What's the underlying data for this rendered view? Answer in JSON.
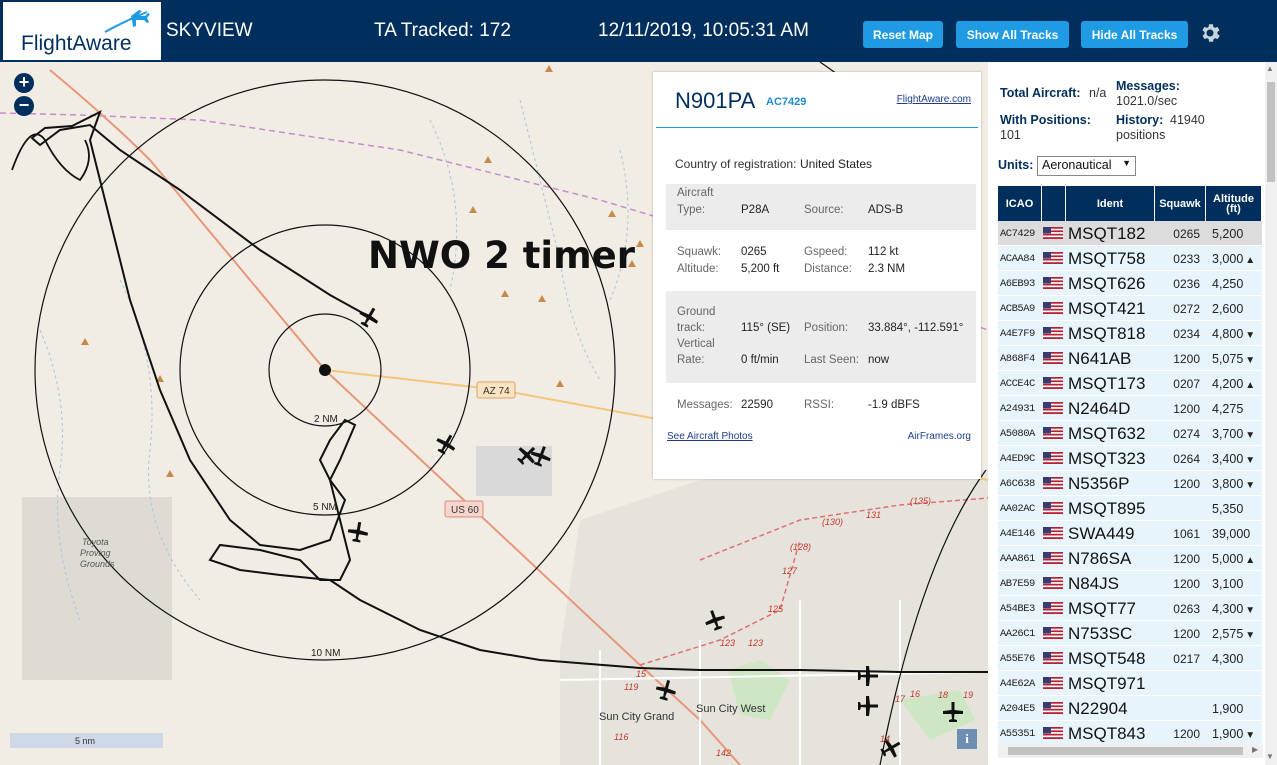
{
  "header": {
    "logo_text": "FlightAware",
    "app_title": "SKYVIEW",
    "ta_tracked": "TA Tracked: 172",
    "datetime": "12/11/2019, 10:05:31 AM",
    "reset_map": "Reset Map",
    "show_all_tracks": "Show All Tracks",
    "hide_all_tracks": "Hide All Tracks",
    "settings_icon": "gear-icon",
    "bg_color": "#002f5d",
    "button_color": "#1e9be3"
  },
  "map": {
    "zoom_in": "+",
    "zoom_out": "−",
    "annotation": "NWO 2 timer",
    "ring_labels": [
      "2 NM",
      "5 NM",
      "10 NM"
    ],
    "road_labels": [
      "AZ 74",
      "US 60"
    ],
    "place_labels": [
      "Toyota",
      "Proving",
      "Grounds",
      "Sun City Grand",
      "Sun City West"
    ],
    "route_numbers": [
      "(135)",
      "(130)",
      "131",
      "(128)",
      "127",
      "125",
      "123",
      "123",
      "17",
      "16",
      "18",
      "19",
      "15",
      "119",
      "116",
      "142",
      "14"
    ],
    "scale_label": "5 nm",
    "info_icon": "i"
  },
  "popup": {
    "registration": "N901PA",
    "icao": "AC7429",
    "link_flightaware": "FlightAware.com",
    "country_label": "Country of registration:",
    "country_value": "United States",
    "aircraft_type_label_1": "Aircraft",
    "aircraft_type_label_2": "Type:",
    "aircraft_type_value": "P28A",
    "source_label": "Source:",
    "source_value": "ADS-B",
    "squawk_label": "Squawk:",
    "squawk_value": "0265",
    "gspeed_label": "Gspeed:",
    "gspeed_value": "112 kt",
    "altitude_label": "Altitude:",
    "altitude_value": "5,200 ft",
    "distance_label": "Distance:",
    "distance_value": "2.3 NM",
    "track_label_1": "Ground",
    "track_label_2": "track:",
    "track_value": "115° (SE)",
    "position_label": "Position:",
    "position_value": "33.884°, -112.591°",
    "vrate_label_1": "Vertical",
    "vrate_label_2": "Rate:",
    "vrate_value": "0 ft/min",
    "last_seen_label": "Last Seen:",
    "last_seen_value": "now",
    "messages_label": "Messages:",
    "messages_value": "22590",
    "rssi_label": "RSSI:",
    "rssi_value": "-1.9 dBFS",
    "link_photos": "See Aircraft Photos",
    "link_airframes": "AirFrames.org"
  },
  "sidebar": {
    "total_label": "Total Aircraft:",
    "total_value": "n/a",
    "messages_label": "Messages:",
    "messages_value": "1021.0/sec",
    "positions_label": "With Positions:",
    "positions_value": "101",
    "history_label": "History:",
    "history_value_1": "41940",
    "history_value_2": "positions",
    "units_label": "Units:",
    "units_value": "Aeronautical",
    "columns": [
      "ICAO",
      "Ident",
      "Squawk",
      "Altitude (ft)"
    ],
    "rows": [
      {
        "icao": "AC7429",
        "ident": "MSQT182",
        "squawk": "0265",
        "alt": "5,200",
        "trend": "",
        "selected": true
      },
      {
        "icao": "ACAA84",
        "ident": "MSQT758",
        "squawk": "0233",
        "alt": "3,000",
        "trend": "▲"
      },
      {
        "icao": "A6EB93",
        "ident": "MSQT626",
        "squawk": "0236",
        "alt": "4,250",
        "trend": ""
      },
      {
        "icao": "ACB5A9",
        "ident": "MSQT421",
        "squawk": "0272",
        "alt": "2,600",
        "trend": ""
      },
      {
        "icao": "A4E7F9",
        "ident": "MSQT818",
        "squawk": "0234",
        "alt": "4,800",
        "trend": "▼"
      },
      {
        "icao": "A868F4",
        "ident": "N641AB",
        "squawk": "1200",
        "alt": "5,075",
        "trend": "▼"
      },
      {
        "icao": "ACCE4C",
        "ident": "MSQT173",
        "squawk": "0207",
        "alt": "4,200",
        "trend": "▲"
      },
      {
        "icao": "A24931",
        "ident": "N2464D",
        "squawk": "1200",
        "alt": "4,275",
        "trend": ""
      },
      {
        "icao": "A5080A",
        "ident": "MSQT632",
        "squawk": "0274",
        "alt": "3,700",
        "trend": "▼"
      },
      {
        "icao": "A4ED9C",
        "ident": "MSQT323",
        "squawk": "0264",
        "alt": "3,400",
        "trend": "▼"
      },
      {
        "icao": "A6C638",
        "ident": "N5356P",
        "squawk": "1200",
        "alt": "3,800",
        "trend": "▼"
      },
      {
        "icao": "AA02AC",
        "ident": "MSQT895",
        "squawk": "",
        "alt": "5,350",
        "trend": ""
      },
      {
        "icao": "A4E146",
        "ident": "SWA449",
        "squawk": "1061",
        "alt": "39,000",
        "trend": ""
      },
      {
        "icao": "AAA861",
        "ident": "N786SA",
        "squawk": "1200",
        "alt": "5,000",
        "trend": "▲"
      },
      {
        "icao": "AB7E59",
        "ident": "N84JS",
        "squawk": "1200",
        "alt": "3,100",
        "trend": ""
      },
      {
        "icao": "A54BE3",
        "ident": "MSQT77",
        "squawk": "0263",
        "alt": "4,300",
        "trend": "▼"
      },
      {
        "icao": "AA26C1",
        "ident": "N753SC",
        "squawk": "1200",
        "alt": "2,575",
        "trend": "▼"
      },
      {
        "icao": "A55E76",
        "ident": "MSQT548",
        "squawk": "0217",
        "alt": "4,300",
        "trend": ""
      },
      {
        "icao": "A4E62A",
        "ident": "MSQT971",
        "squawk": "",
        "alt": "",
        "trend": ""
      },
      {
        "icao": "A204E5",
        "ident": "N22904",
        "squawk": "",
        "alt": "1,900",
        "trend": ""
      },
      {
        "icao": "A55351",
        "ident": "MSQT843",
        "squawk": "1200",
        "alt": "1,900",
        "trend": "▼"
      }
    ]
  }
}
